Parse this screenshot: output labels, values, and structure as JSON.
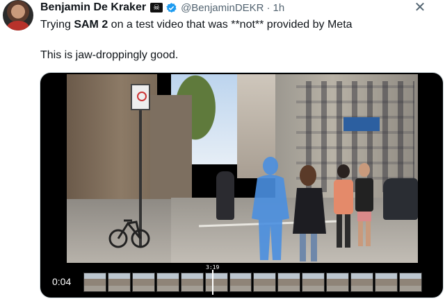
{
  "author": {
    "name": "Benjamin De Kraker",
    "handle": "@BenjaminDEKR",
    "separator": "·",
    "time": "1h",
    "flag_icon": "skull-flag-icon",
    "verified_icon": "verified-badge-icon"
  },
  "tweet": {
    "line1_prefix": "Trying ",
    "line1_bold": "SAM 2",
    "line1_suffix": " on a test video that was **not** provided by Meta",
    "line2": "This is jaw-droppingly good."
  },
  "media": {
    "timecode": "3:19",
    "duration": "0:04",
    "thumbnail_count": 14
  },
  "colors": {
    "text": "#0f1419",
    "secondary": "#536471",
    "verified": "#1d9bf0",
    "segment_highlight": "#4a8fe0"
  }
}
